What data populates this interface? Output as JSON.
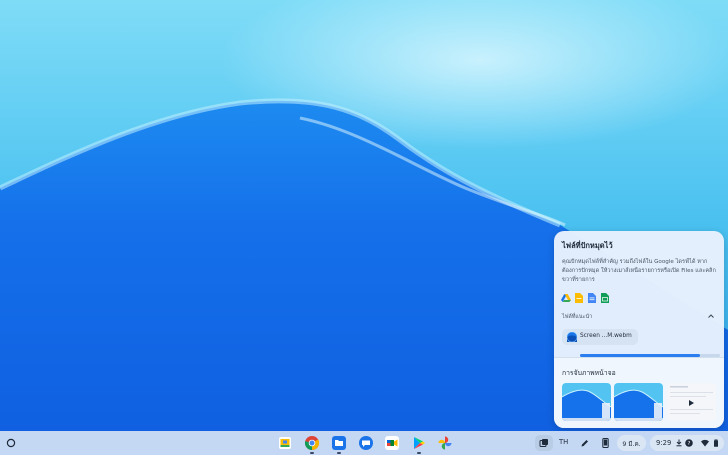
{
  "holding_space": {
    "pinned_title": "ไฟล์ที่ปักหมุดไว้",
    "pinned_description": "คุณปักหมุดไฟล์ที่สำคัญ รวมถึงไฟล์ใน Google ไดรฟ์ได้ หากต้องการปักหมุด ให้วางเมาส์เหนือรายการหรือเปิด Files และคลิกขวาที่รายการ",
    "app_icons": [
      "google-drive-icon",
      "google-docs-icon",
      "google-slides-icon",
      "google-sheets-icon"
    ],
    "suggestions_label": "ไฟล์ที่แนะนำ",
    "suggested_file": "Screen ...M.webm",
    "screenshots_title": "การจับภาพหน้าจอ",
    "screenshots": [
      "wallpaper-screenshot",
      "wallpaper-screenshot",
      "video-screenshot"
    ],
    "progress": 0.86
  },
  "shelf": {
    "apps": [
      "files-icon-app",
      "chrome",
      "files",
      "messages",
      "google-meet",
      "play-store",
      "google-photos"
    ],
    "ime": "TH",
    "date": "9 มี.ค.",
    "time": "9:29"
  },
  "colors": {
    "accent": "#2a7ef0",
    "panel_bg": "#e8f1fc",
    "shelf_bg": "#d2e1f5"
  }
}
